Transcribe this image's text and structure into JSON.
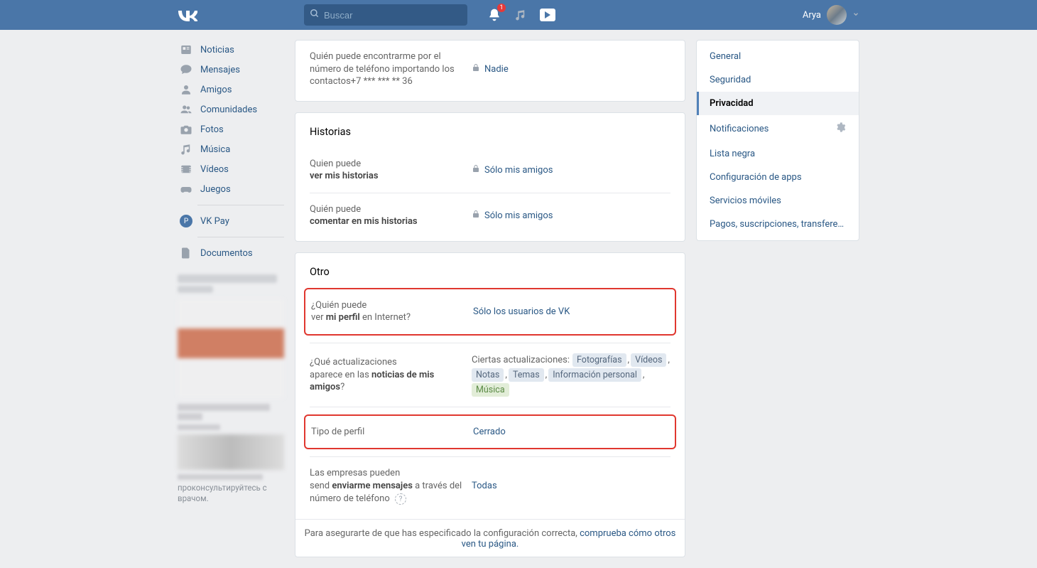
{
  "header": {
    "search_placeholder": "Buscar",
    "notif_badge": "1",
    "user_name": "Arya"
  },
  "leftnav": {
    "items": [
      {
        "label": "Noticias"
      },
      {
        "label": "Mensajes"
      },
      {
        "label": "Amigos"
      },
      {
        "label": "Comunidades"
      },
      {
        "label": "Fotos"
      },
      {
        "label": "Música"
      },
      {
        "label": "Vídeos"
      },
      {
        "label": "Juegos"
      }
    ],
    "pay_label": "VK Pay",
    "docs_label": "Documentos",
    "ad_footer": "проконсультируйтесь с врачом."
  },
  "settings": {
    "phone_find": {
      "label_line1": "Quién puede encontrarme por el número de teléfono importando los contactos+7 *** *** ** 36",
      "value": "Nadie"
    },
    "stories_title": "Historias",
    "stories_view": {
      "label_pre": "Quien puede",
      "label_bold": "ver mis historias",
      "value": "Sólo mis amigos"
    },
    "stories_comment": {
      "label_pre": "Quién puede",
      "label_bold": "comentar en mis historias",
      "value": "Sólo mis amigos"
    },
    "other_title": "Otro",
    "profile_visibility": {
      "label_pre": "¿Quién puede",
      "label_mid": "ver ",
      "label_bold": "mi perfil",
      "label_post": " en Internet?",
      "value": "Sólo los usuarios de VK"
    },
    "updates": {
      "label_pre": "¿Qué actualizaciones",
      "label_mid": "aparece en las ",
      "label_bold": "noticias de mis amigos",
      "label_post": "?",
      "prefix": "Ciertas actualizaciones:",
      "tags": [
        "Fotografías",
        "Vídeos",
        "Notas",
        "Temas",
        "Información personal",
        "Música"
      ],
      "ok_index": 5
    },
    "profile_type": {
      "label": "Tipo de perfil",
      "value": "Cerrado"
    },
    "companies": {
      "label_line1": "Las empresas pueden",
      "label_pre2": "send ",
      "label_bold": "enviarme mensajes",
      "label_post": " a través del número de teléfono ",
      "value": "Todas"
    },
    "footer_pre": "Para asegurarte de que has especificado la configuración correcta, ",
    "footer_link": "comprueba cómo otros ven tu página."
  },
  "rightmenu": {
    "items": [
      "General",
      "Seguridad",
      "Privacidad",
      "Notificaciones",
      "Lista negra",
      "Configuración de apps",
      "Servicios móviles",
      "Pagos, suscripciones, transferencias"
    ],
    "active_index": 2,
    "gear_index": 3
  }
}
